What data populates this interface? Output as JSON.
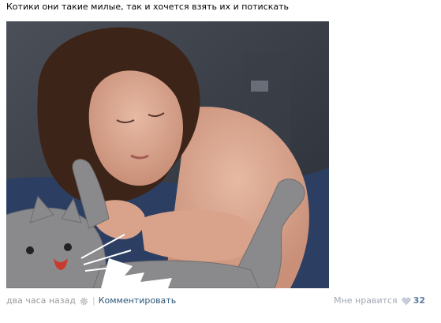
{
  "post": {
    "text": "Котики они такие милые, так и хочется взять их и потискать"
  },
  "footer": {
    "time": "два часа назад",
    "separator": "|",
    "comment_label": "Комментировать",
    "like_label": "Мне нравится",
    "like_count": "32"
  },
  "colors": {
    "link": "#2b587a",
    "meta_gray": "#9c9c9c",
    "like_count": "#5a7da2"
  }
}
